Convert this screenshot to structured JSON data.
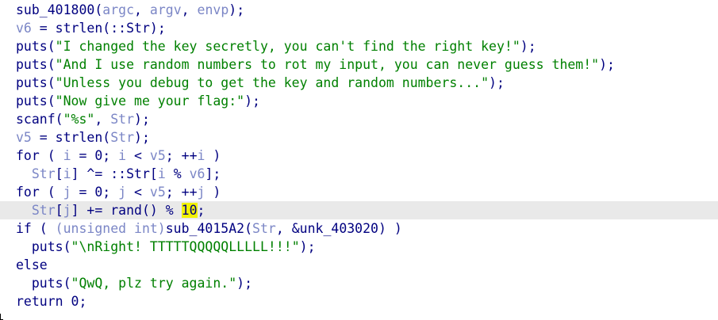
{
  "code": {
    "l1_fn": "sub_401800",
    "l1_open": "(",
    "l1_a1": "argc",
    "l1_c1": ", ",
    "l1_a2": "argv",
    "l1_c2": ", ",
    "l1_a3": "envp",
    "l1_close": ");",
    "l2_lhs": "v6",
    "l2_mid": " = strlen(::Str);",
    "l3_fn": "puts(",
    "l3_str": "\"I changed the key secretly, you can't find the right key!\"",
    "l3_end": ");",
    "l4_fn": "puts(",
    "l4_str": "\"And I use random numbers to rot my input, you can never guess them!\"",
    "l4_end": ");",
    "l5_fn": "puts(",
    "l5_str": "\"Unless you debug to get the key and random numbers...\"",
    "l5_end": ");",
    "l6_fn": "puts(",
    "l6_str": "\"Now give me your flag:\"",
    "l6_end": ");",
    "l7_fn": "scanf(",
    "l7_str": "\"%s\"",
    "l7_c": ", ",
    "l7_arg": "Str",
    "l7_end": ");",
    "l8_lhs": "v5",
    "l8_mid": " = strlen(",
    "l8_arg": "Str",
    "l8_end": ");",
    "l9_a": "for ( ",
    "l9_i1": "i",
    "l9_b": " = 0; ",
    "l9_i2": "i",
    "l9_c": " < ",
    "l9_v5": "v5",
    "l9_d": "; ++",
    "l9_i3": "i",
    "l9_e": " )",
    "l10_ind": "  ",
    "l10_str": "Str",
    "l10_a": "[",
    "l10_i1": "i",
    "l10_b": "] ^= ::Str[",
    "l10_i2": "i",
    "l10_c": " % ",
    "l10_v6": "v6",
    "l10_d": "];",
    "l11_a": "for ( ",
    "l11_j1": "j",
    "l11_b": " = 0; ",
    "l11_j2": "j",
    "l11_c": " < ",
    "l11_v5": "v5",
    "l11_d": "; ++",
    "l11_j3": "j",
    "l11_e": " )",
    "l12_ind": "  ",
    "l12_str": "Str",
    "l12_a": "[",
    "l12_j": "j",
    "l12_b": "] += rand() % ",
    "l12_num": "10",
    "l12_end": ";",
    "l13_a": "if ( ",
    "l13_cast": "(unsigned int)",
    "l13_fn": "sub_4015A2(",
    "l13_arg": "Str",
    "l13_b": ", &unk_403020) )",
    "l14_ind": "  ",
    "l14_fn": "puts(",
    "l14_str": "\"\\nRight! TTTTTQQQQQLLLLL!!!\"",
    "l14_end": ");",
    "l15": "else",
    "l16_ind": "  ",
    "l16_fn": "puts(",
    "l16_str": "\"QwQ, plz try again.\"",
    "l16_end": ");",
    "l17": "return 0;"
  }
}
